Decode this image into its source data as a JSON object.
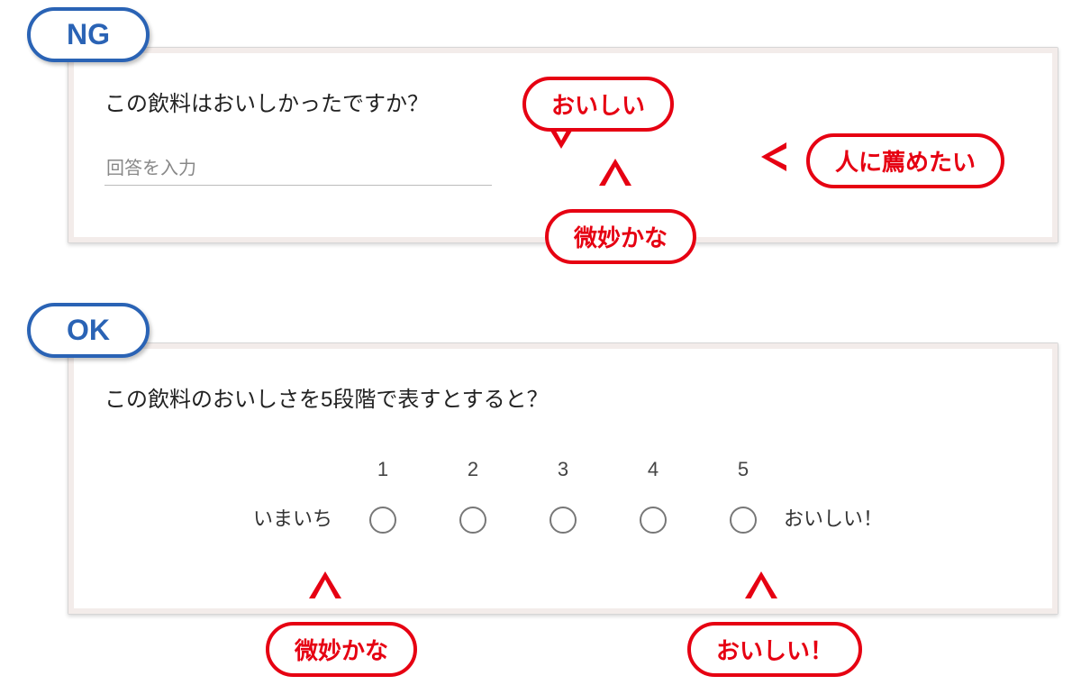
{
  "ng": {
    "label": "NG",
    "question": "この飲料はおいしかったですか？",
    "placeholder": "回答を入力",
    "bubbles": {
      "tasty": "おいしい",
      "recommend": "人に薦めたい",
      "soso": "微妙かな"
    }
  },
  "ok": {
    "label": "OK",
    "question": "この飲料のおいしさを5段階で表すとすると？",
    "scale": {
      "low_label": "いまいち",
      "high_label": "おいしい！",
      "n1": "1",
      "n2": "2",
      "n3": "3",
      "n4": "4",
      "n5": "5"
    },
    "bubbles": {
      "soso": "微妙かな",
      "tasty": "おいしい！"
    }
  }
}
